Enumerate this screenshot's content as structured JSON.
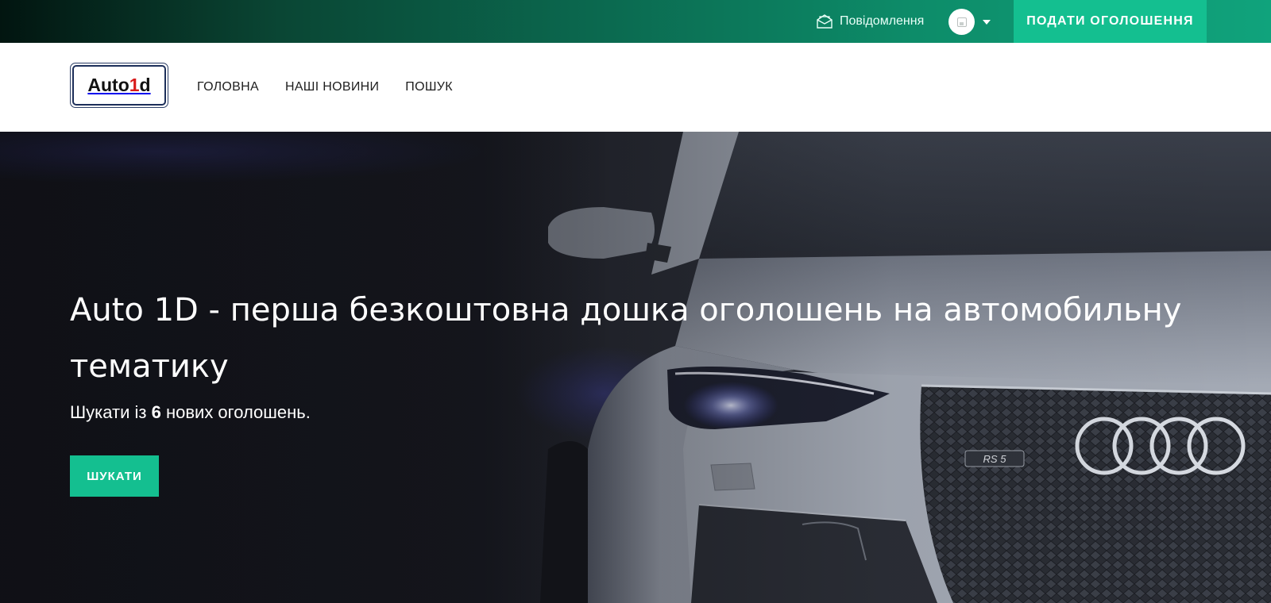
{
  "topbar": {
    "messages_label": "Повідомлення",
    "post_ad_label": "ПОДАТИ ОГОЛОШЕННЯ"
  },
  "header": {
    "logo": {
      "text_before": "Auto",
      "text_accent": "1",
      "text_after": "d"
    },
    "nav": [
      {
        "label": "ГОЛОВНА"
      },
      {
        "label": "НАШІ НОВИНИ"
      },
      {
        "label": "ПОШУК"
      }
    ]
  },
  "hero": {
    "title": "Auto 1D - перша безкоштовна дошка оголошень на автомобильну тематику",
    "subtitle_prefix": "Шукати із ",
    "subtitle_count": "6",
    "subtitle_suffix": " нових оголошень.",
    "search_label": "ШУКАТИ"
  },
  "colors": {
    "accent": "#14bf90",
    "topbar_start": "#021510",
    "topbar_end": "#10a37c",
    "logo_border": "#1d2f5a",
    "logo_accent": "#d81b1b"
  },
  "icons": {
    "messages": "envelope-icon",
    "avatar": "image-placeholder-icon",
    "dropdown": "caret-down-icon"
  }
}
